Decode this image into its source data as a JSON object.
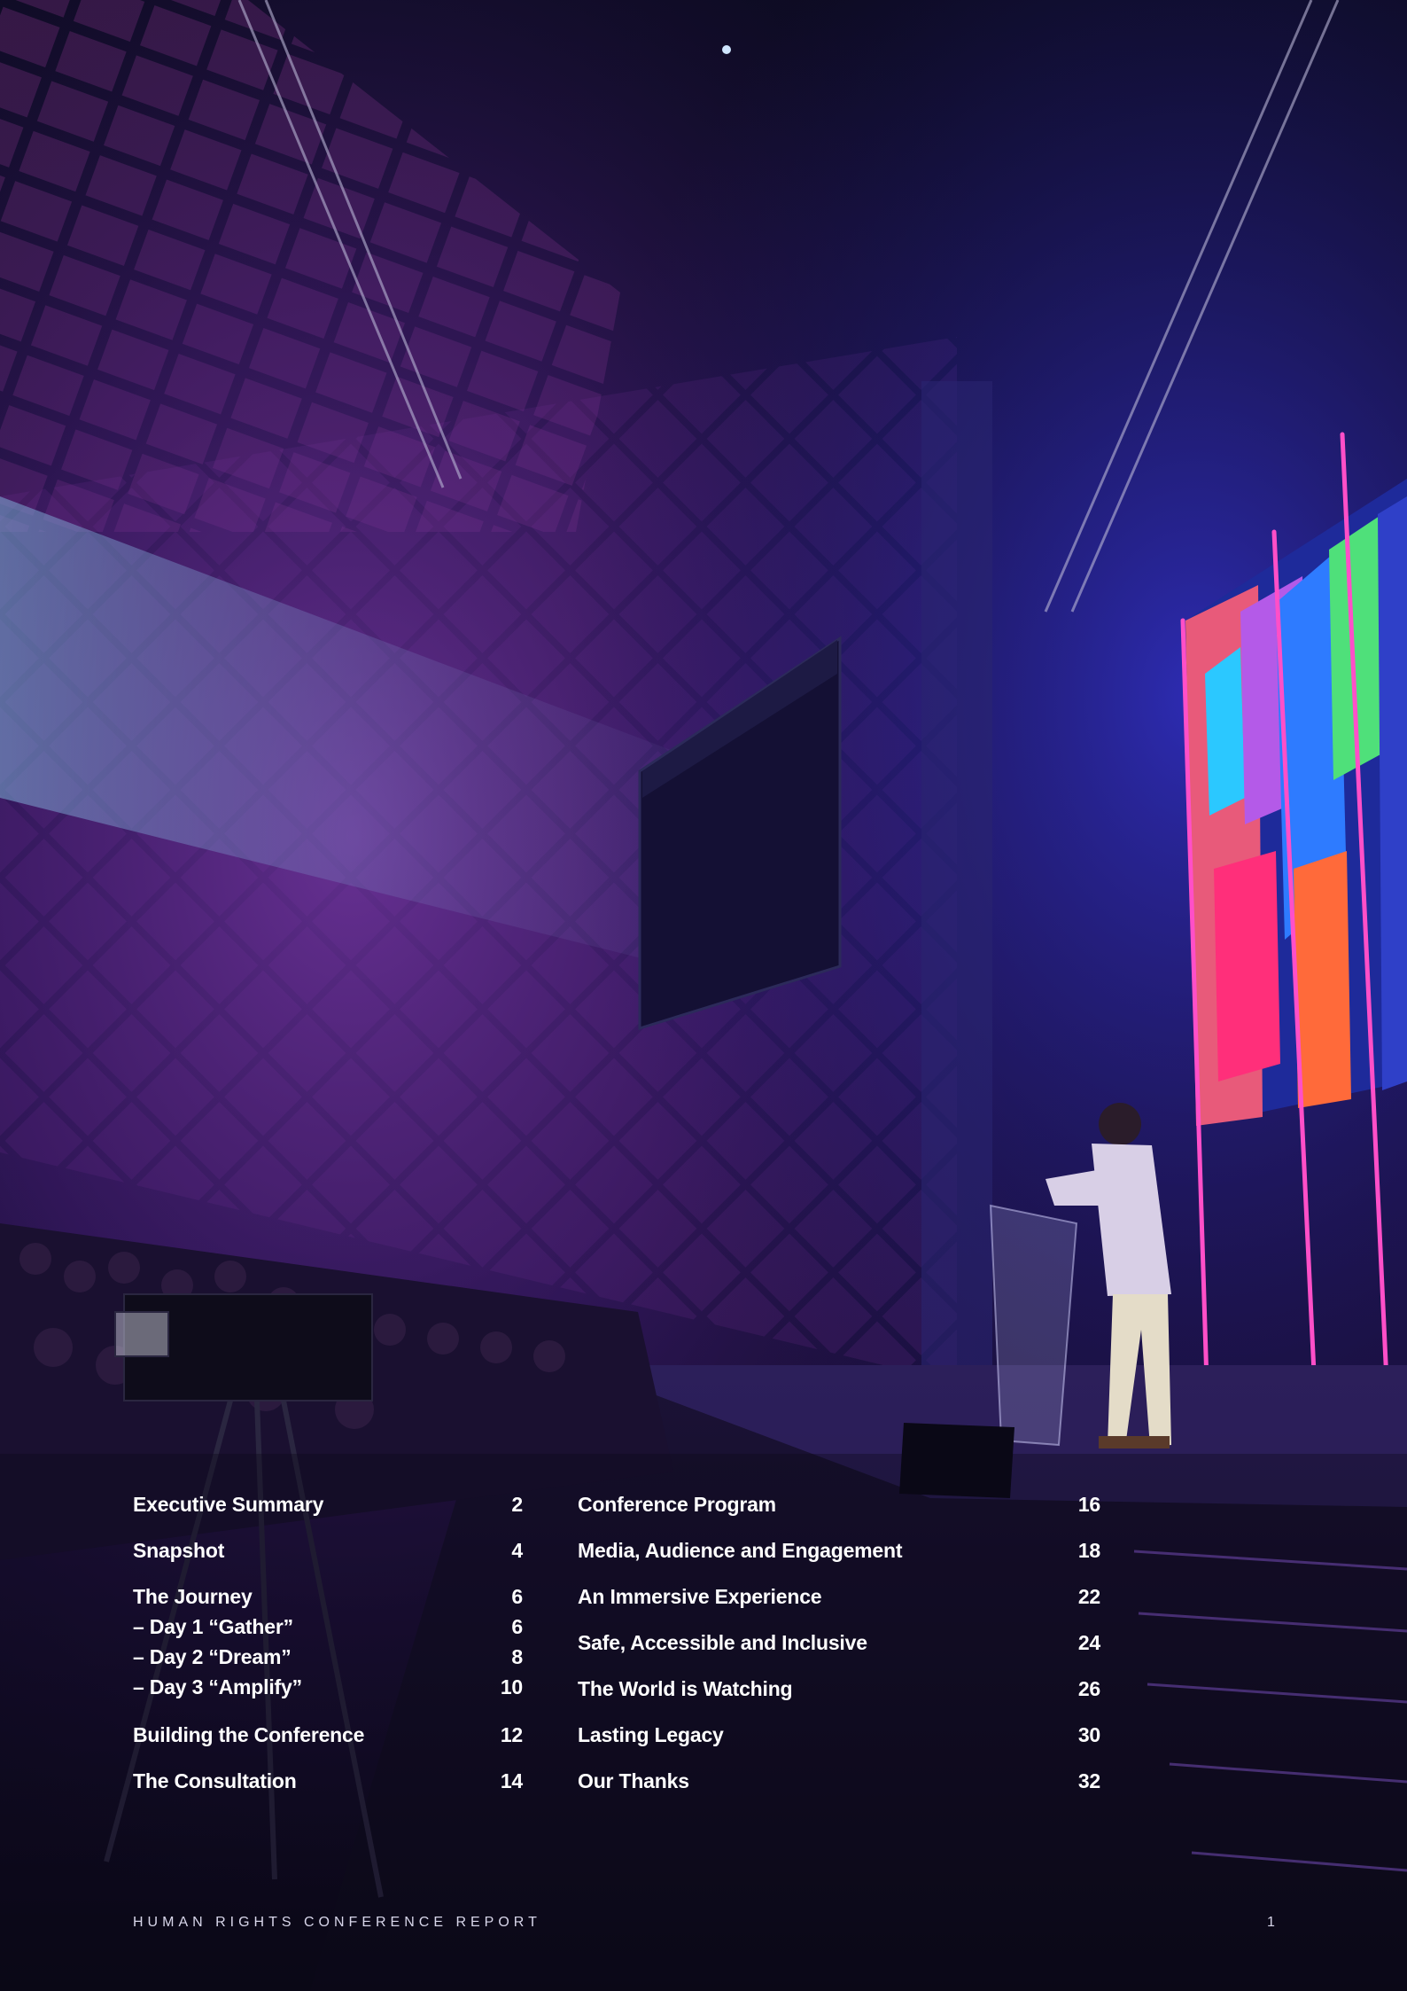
{
  "toc": {
    "left": [
      {
        "label": "Executive Summary",
        "page": "2"
      },
      {
        "label": "Snapshot",
        "page": "4"
      },
      {
        "label": "The Journey",
        "page": "6",
        "sub": [
          {
            "label": "– Day 1 “Gather”",
            "page": "6"
          },
          {
            "label": "– Day 2 “Dream”",
            "page": "8"
          },
          {
            "label": "– Day 3 “Amplify”",
            "page": "10"
          }
        ]
      },
      {
        "label": "Building the Conference",
        "page": "12"
      },
      {
        "label": "The Consultation",
        "page": "14"
      }
    ],
    "right": [
      {
        "label": "Conference Program",
        "page": "16"
      },
      {
        "label": "Media, Audience and Engagement",
        "page": "18"
      },
      {
        "label": "An Immersive Experience",
        "page": "22"
      },
      {
        "label": "Safe, Accessible and Inclusive",
        "page": "24"
      },
      {
        "label": "The World is Watching",
        "page": "26"
      },
      {
        "label": "Lasting Legacy",
        "page": "30"
      },
      {
        "label": "Our Thanks",
        "page": "32"
      }
    ]
  },
  "footer": {
    "report_title": "HUMAN RIGHTS CONFERENCE REPORT",
    "page_number": "1"
  },
  "colors": {
    "background": "#0c0a1e",
    "purple_haze": "#5a2a8a",
    "neon_pink": "#ff4fc8",
    "stage_blue": "#2a2aa8",
    "text": "#ffffff"
  }
}
